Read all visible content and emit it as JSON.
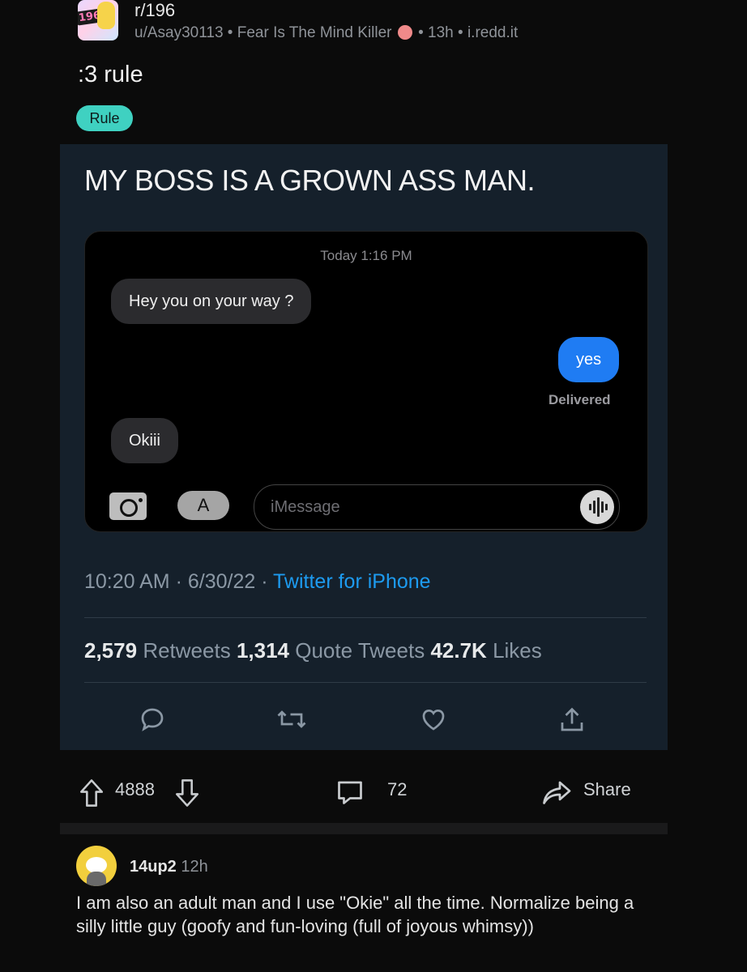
{
  "post": {
    "subreddit": "r/196",
    "avatar_text": "196!",
    "author": "u/Asay30113",
    "author_flair": "Fear Is The Mind Killer",
    "time_ago": "13h",
    "domain": "i.redd.it",
    "title": ":3 rule",
    "flair": "Rule"
  },
  "tweet": {
    "text": "MY BOSS IS A GROWN ASS MAN.",
    "imessage": {
      "timestamp": "Today 1:16 PM",
      "msg1": "Hey you on your way ?",
      "msg2": "yes",
      "status": "Delivered",
      "msg3": "Okiii",
      "input_placeholder": "iMessage"
    },
    "posted_time": "10:20 AM · 6/30/22 ·",
    "client": "Twitter for iPhone",
    "retweets": "2,579",
    "retweets_label": "Retweets",
    "quotes": "1,314",
    "quotes_label": "Quote Tweets",
    "likes": "42.7K",
    "likes_label": "Likes"
  },
  "actions": {
    "votes": "4888",
    "comments": "72",
    "share": "Share"
  },
  "comment": {
    "user": "14up2",
    "time": "12h",
    "body": "I am also an adult man and I use \"Okie\" all the time. Normalize being a silly little guy (goofy and fun-loving (full of joyous whimsy))"
  },
  "colors": {
    "accent_blue": "#1d9bf0",
    "imessage_blue": "#1f7cf3",
    "flair_teal": "#3fd1c1",
    "tweet_bg": "#15202b"
  }
}
